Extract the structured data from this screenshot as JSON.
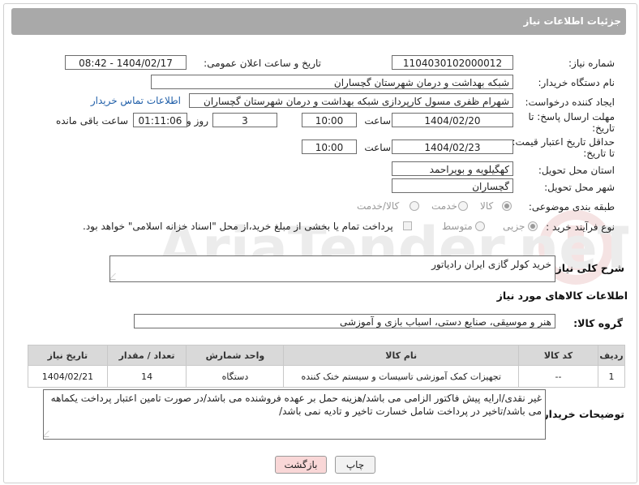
{
  "header": {
    "title": "جزئیات اطلاعات نیاز"
  },
  "form": {
    "need_number_label": "شماره نیاز:",
    "need_number": "1104030102000012",
    "announce_label": "تاریخ و ساعت اعلان عمومی:",
    "announce_value": "1404/02/17 - 08:42",
    "buyer_org_label": "نام دستگاه خریدار:",
    "buyer_org": "شبکه بهداشت و درمان شهرستان گچساران",
    "creator_label": "ایجاد کننده درخواست:",
    "creator": "شهرام ظفری مسول کارپردازی  شبکه بهداشت و درمان شهرستان گچساران",
    "contact_link": "اطلاعات تماس خریدار",
    "deadline_label_1": "مهلت ارسال پاسخ: تا",
    "deadline_label_2": "تاریخ:",
    "deadline_date": "1404/02/20",
    "time_label": "ساعت",
    "deadline_time": "10:00",
    "days_value": "3",
    "days_label": "روز و",
    "remaining_value": "01:11:06",
    "remaining_label": "ساعت باقی مانده",
    "validity_label_1": "حداقل تاریخ اعتبار قیمت:",
    "validity_label_2": "تا تاریخ:",
    "validity_date": "1404/02/23",
    "validity_time": "10:00",
    "province_label": "استان محل تحویل:",
    "province": "کهگیلویه و بویراحمد",
    "city_label": "شهر محل تحویل:",
    "city": "گچساران",
    "category_label": "طبقه بندی موضوعی:",
    "category_options": [
      "کالا",
      "خدمت",
      "کالا/خدمت"
    ],
    "process_label": "نوع فرآیند خرید :",
    "process_options": [
      "جزیی",
      "متوسط"
    ],
    "payment_note": "پرداخت تمام یا بخشی از مبلغ خرید،از محل \"اسناد خزانه اسلامی\" خواهد بود.",
    "summary_label": "شرح کلی نیاز:",
    "summary": "خرید کولر گازی ایران رادیاتور",
    "goods_info_title": "اطلاعات کالاهای مورد نیاز",
    "goods_group_label": "گروه کالا:",
    "goods_group": "هنر و موسیقی، صنایع دستی، اسباب بازی و آموزشی",
    "buyer_notes_label": "توضیحات خریدار:",
    "buyer_notes": "غیر نقدی/ارایه پیش فاکتور الزامی می باشد/هزینه حمل بر عهده فروشنده می باشد/در صورت تامین اعتبار پرداخت یکماهه می باشد/تاخیر در پرداخت شامل خسارت تاخیر و تادیه نمی باشد/"
  },
  "table": {
    "headers": [
      "ردیف",
      "کد کالا",
      "نام کالا",
      "واحد شمارش",
      "تعداد / مقدار",
      "تاریخ نیاز"
    ],
    "rows": [
      [
        "1",
        "--",
        "تجهیزات کمک آموزشی تاسیسات و سیستم خنک کننده",
        "دستگاه",
        "14",
        "1404/02/21"
      ]
    ]
  },
  "buttons": {
    "print": "چاپ",
    "back": "بازگشت"
  },
  "watermark": {
    "text": "AriaTender.neT"
  },
  "colors": {
    "header": "#a9a9a9",
    "link": "#1f5ea8",
    "back_button": "#f9d7d7"
  }
}
